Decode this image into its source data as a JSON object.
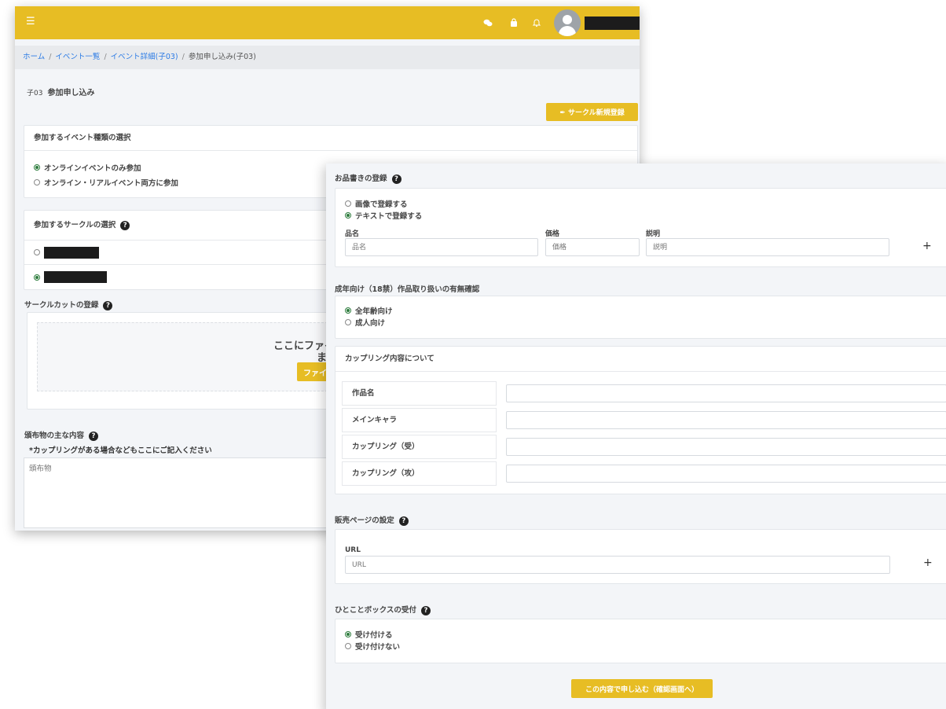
{
  "topbar": {
    "menu_icon": "hamburger-icon",
    "icons": [
      "chat-icon",
      "cart-icon",
      "bell-icon",
      "user-icon"
    ]
  },
  "breadcrumb": {
    "home": "ホーム",
    "events": "イベント一覧",
    "event_detail": "イベント詳細(子03)",
    "current": "参加申し込み(子03)"
  },
  "page": {
    "title_prefix": "子03",
    "title": "参加申し込み",
    "new_circle_button": "サークル新規登録"
  },
  "event_type": {
    "heading": "参加するイベント種類の選択",
    "options": [
      "オンラインイベントのみ参加",
      "オンライン・リアルイベント両方に参加"
    ],
    "selected": 0
  },
  "circle_select": {
    "heading": "参加するサークルの選択",
    "selected": 1
  },
  "circle_cut": {
    "heading": "サークルカットの登録",
    "drop_text_1": "ここにファイ",
    "drop_text_2": "ま",
    "file_button": "ファイ"
  },
  "distribution": {
    "heading": "頒布物の主な内容",
    "note": "*カップリングがある場合などもここにご記入ください",
    "placeholder": "頒布物"
  },
  "menu_card": {
    "heading": "お品書きの登録",
    "options": [
      "画像で登録する",
      "テキストで登録する"
    ],
    "selected": 1,
    "name_label": "品名",
    "name_placeholder": "品名",
    "price_label": "価格",
    "price_placeholder": "価格",
    "desc_label": "説明",
    "desc_placeholder": "説明",
    "add": "+"
  },
  "adult": {
    "heading": "成年向け（18禁）作品取り扱いの有無確認",
    "options": [
      "全年齢向け",
      "成人向け"
    ],
    "selected": 0
  },
  "coupling": {
    "heading": "カップリング内容について",
    "rows": [
      "作品名",
      "メインキャラ",
      "カップリング（受）",
      "カップリング（攻）"
    ]
  },
  "sales_page": {
    "heading": "販売ページの設定",
    "url_label": "URL",
    "url_placeholder": "URL",
    "add": "+"
  },
  "comment_box": {
    "heading": "ひとことボックスの受付",
    "options": [
      "受け付ける",
      "受け付けない"
    ],
    "selected": 0
  },
  "submit_button": "この内容で申し込む（確認画面へ）",
  "colors": {
    "accent": "#e7bd24",
    "link": "#2c7be5",
    "radio_on": "#2d7c3d"
  }
}
